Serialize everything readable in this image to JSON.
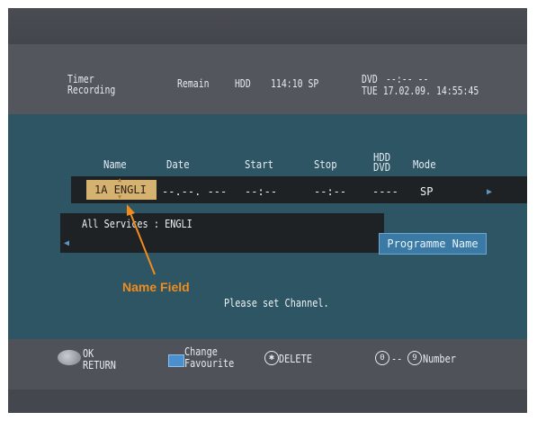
{
  "header": {
    "title_line1": "Timer",
    "title_line2": "Recording",
    "remain_label": "Remain",
    "hdd_label": "HDD",
    "hdd_value": "114:10 SP",
    "dvd_label": "DVD",
    "dvd_value": "--:-- --",
    "datetime": "TUE 17.02.09. 14:55:45"
  },
  "columns": {
    "name": "Name",
    "date": "Date",
    "start": "Start",
    "stop": "Stop",
    "hdd_dvd_line1": "HDD",
    "hdd_dvd_line2": "DVD",
    "mode": "Mode"
  },
  "row": {
    "name": "1A ENGLI",
    "date": "--.--. ---",
    "start": "--:--",
    "stop": "--:--",
    "hdd_dvd": "----",
    "mode": "SP",
    "next_arrow": "▶"
  },
  "services": {
    "label": "All Services : ENGLI",
    "left_arrow": "◀"
  },
  "programme_name_button": "Programme Name",
  "annotation": "Name Field",
  "message": "Please set Channel.",
  "footer": {
    "ok": "OK",
    "return": "RETURN",
    "change_line1": "Change",
    "change_line2": "Favourite",
    "delete": "DELETE",
    "number_range_start": "0",
    "number_range_sep": "--",
    "number_range_end": "9",
    "number": "Number"
  },
  "colors": {
    "accent_orange": "#f28c1c",
    "name_field": "#d6b271",
    "blue_button": "#3b7aa5",
    "teal_panel": "#2d5563"
  }
}
